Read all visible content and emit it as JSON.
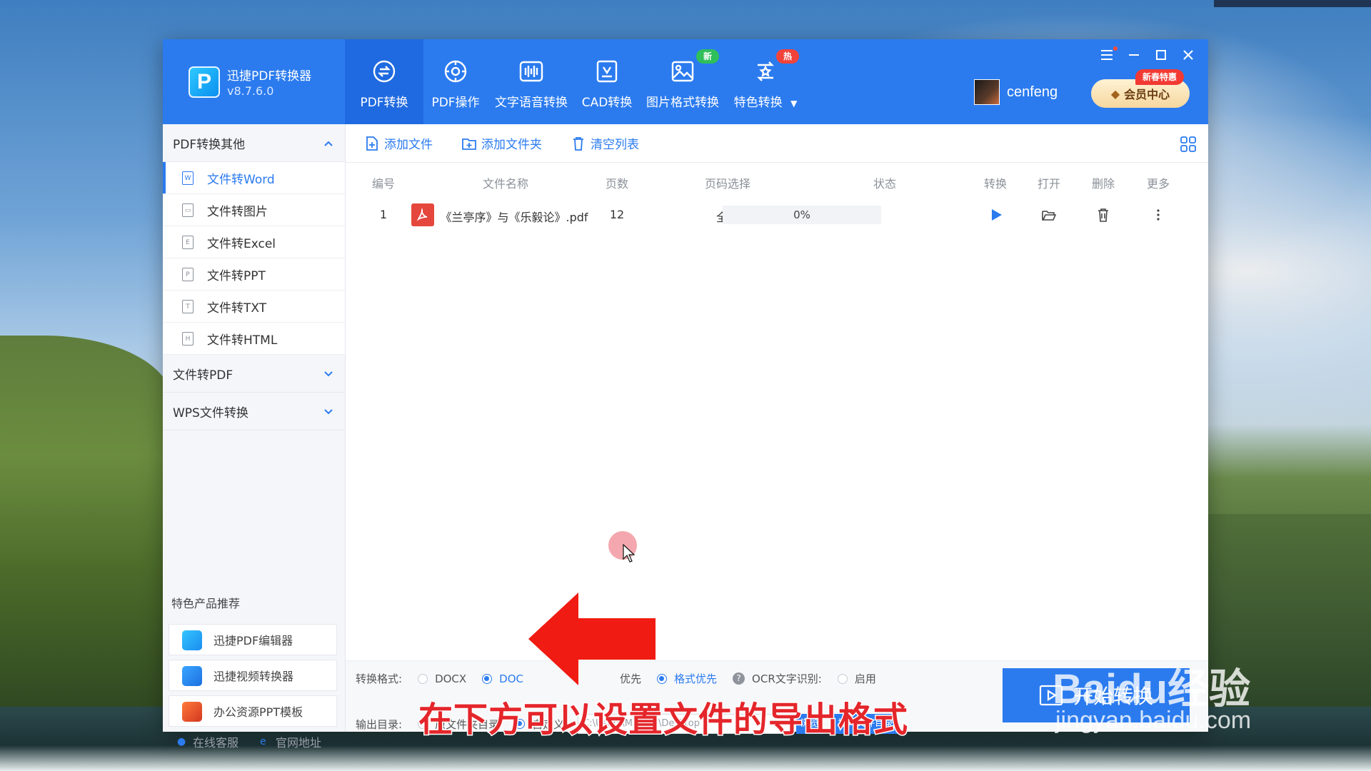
{
  "app": {
    "name": "迅捷PDF转换器",
    "version": "v8.7.6.0",
    "logo_letter": "P"
  },
  "nav": [
    {
      "label": "PDF转换",
      "icon": "pdf-convert-icon",
      "active": true
    },
    {
      "label": "PDF操作",
      "icon": "pdf-operate-icon"
    },
    {
      "label": "文字语音转换",
      "icon": "audio-wave-icon"
    },
    {
      "label": "CAD转换",
      "icon": "cad-icon"
    },
    {
      "label": "图片格式转换",
      "icon": "image-icon",
      "badge": "新"
    },
    {
      "label": "特色转换",
      "icon": "star-swap-icon",
      "badge": "热",
      "has_dropdown": true
    }
  ],
  "user": {
    "name": "cenfeng",
    "vip_label": "会员中心",
    "promo_badge": "新春特惠"
  },
  "sidebar": {
    "groups": [
      {
        "label": "PDF转换其他",
        "expanded": true
      },
      {
        "label": "文件转PDF",
        "expanded": false
      },
      {
        "label": "WPS文件转换",
        "expanded": false
      }
    ],
    "items": [
      {
        "label": "文件转Word",
        "glyph": "W",
        "active": true
      },
      {
        "label": "文件转图片",
        "glyph": "▭"
      },
      {
        "label": "文件转Excel",
        "glyph": "E"
      },
      {
        "label": "文件转PPT",
        "glyph": "P"
      },
      {
        "label": "文件转TXT",
        "glyph": "T"
      },
      {
        "label": "文件转HTML",
        "glyph": "H"
      }
    ],
    "recommend_title": "特色产品推荐",
    "recommend": [
      {
        "label": "迅捷PDF编辑器"
      },
      {
        "label": "迅捷视频转换器"
      },
      {
        "label": "办公资源PPT模板"
      }
    ],
    "footer": {
      "service": "在线客服",
      "website": "官网地址"
    }
  },
  "toolbar": {
    "add_file": "添加文件",
    "add_folder": "添加文件夹",
    "clear_list": "清空列表"
  },
  "table": {
    "headers": [
      "编号",
      "文件名称",
      "页数",
      "页码选择",
      "状态",
      "转换",
      "打开",
      "删除",
      "更多"
    ],
    "rows": [
      {
        "index": "1",
        "name": "《兰亭序》与《乐毅论》.pdf",
        "pages": "12",
        "range": "全部",
        "status": "0%",
        "progress": 0
      }
    ]
  },
  "settings": {
    "format_label": "转换格式:",
    "format_options": [
      "DOCX",
      "DOC"
    ],
    "format_selected": "DOC",
    "mode_partial": "优先",
    "mode_selected": "格式优先",
    "ocr_label": "OCR文字识别:",
    "ocr_option": "启用",
    "output_label": "输出目录:",
    "output_original": "原文件夹目录",
    "output_custom": "自定义:",
    "output_path": "C:\\Users\\Mloong\\Desktop",
    "browse_label": "浏览",
    "open_dir_label": "打开文件目录"
  },
  "start_label": "开始转换",
  "overlay": {
    "subtitle": "在下方可以设置文件的导出格式",
    "watermark_logo": "Baidu经验",
    "watermark_url": "jingyan.baidu.com"
  },
  "colors": {
    "brand_blue": "#2b7bef",
    "nav_active": "#1f6ae0",
    "badge_green": "#2fbf5b",
    "badge_red": "#f2433b",
    "arrow_red": "#f01b12"
  }
}
